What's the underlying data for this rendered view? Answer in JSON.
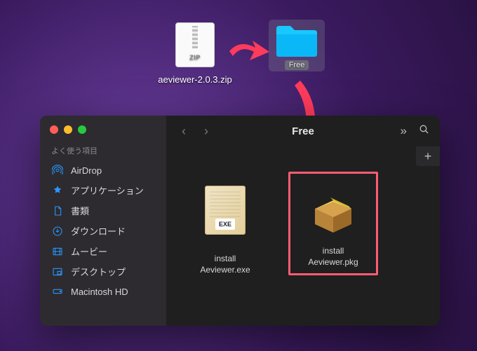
{
  "desktop": {
    "zip": {
      "label": "ZIP",
      "filename": "aeviewer-2.0.3.zip"
    },
    "folder": {
      "name": "Free"
    }
  },
  "finder": {
    "title": "Free",
    "sidebar": {
      "heading": "よく使う項目",
      "items": [
        {
          "label": "AirDrop"
        },
        {
          "label": "アプリケーション"
        },
        {
          "label": "書類"
        },
        {
          "label": "ダウンロード"
        },
        {
          "label": "ムービー"
        },
        {
          "label": "デスクトップ"
        },
        {
          "label": "Macintosh HD"
        }
      ]
    },
    "files": {
      "exe": {
        "badge": "EXE",
        "name_line1": "install",
        "name_line2": "Aeviewer.exe"
      },
      "pkg": {
        "name_line1": "install",
        "name_line2": "Aeviewer.pkg"
      }
    }
  }
}
